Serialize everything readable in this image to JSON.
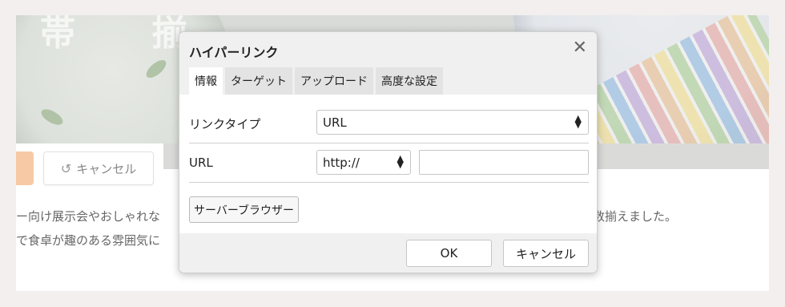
{
  "background": {
    "hero_text": "帯 揃",
    "cancel_button": "キャンセル",
    "body_line1_left": "ー向け展示会やおしゃれな",
    "body_line1_right": "数揃えました。",
    "body_line2": "で食卓が趣のある雰囲気に"
  },
  "dialog": {
    "title": "ハイパーリンク",
    "close_glyph": "✕",
    "tabs": [
      {
        "label": "情報",
        "active": true
      },
      {
        "label": "ターゲット",
        "active": false
      },
      {
        "label": "アップロード",
        "active": false
      },
      {
        "label": "高度な設定",
        "active": false
      }
    ],
    "link_type_label": "リンクタイプ",
    "link_type_value": "URL",
    "url_label": "URL",
    "protocol_value": "http://",
    "url_value": "",
    "browse_button": "サーバーブラウザー",
    "ok_button": "OK",
    "cancel_button": "キャンセル"
  },
  "colors": {
    "page_bg": "#f2efee",
    "dialog_bg": "#f0f0f0",
    "active_tab": "#ffffff",
    "accent_orange": "#f7c9a4"
  },
  "icons": {
    "close": "close-icon",
    "undo": "undo-icon",
    "select_arrows": "select-arrows-icon"
  }
}
